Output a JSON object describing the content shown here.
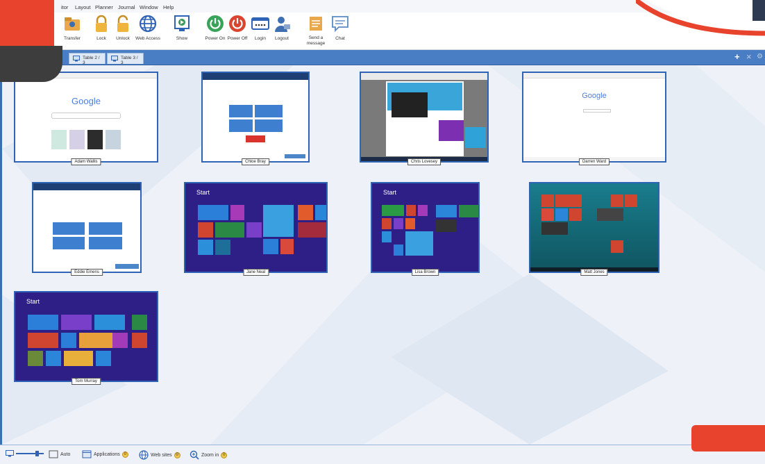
{
  "menu": [
    "itor",
    "Layout",
    "Planner",
    "Journal",
    "Window",
    "Help"
  ],
  "toolbar": [
    {
      "label": "Transfer",
      "icon": "folder-transfer-icon"
    },
    {
      "label": "Lock",
      "icon": "lock-icon"
    },
    {
      "label": "Unlock",
      "icon": "unlock-icon"
    },
    {
      "label": "Web Access",
      "icon": "globe-icon"
    },
    {
      "label": "Show",
      "icon": "show-screen-icon"
    },
    {
      "label": "Power On",
      "icon": "power-on-icon"
    },
    {
      "label": "Power Off",
      "icon": "power-off-icon"
    },
    {
      "label": "Login",
      "icon": "login-icon"
    },
    {
      "label": "Logout",
      "icon": "logout-icon"
    },
    {
      "label": "Send a\nmessage",
      "icon": "message-icon"
    },
    {
      "label": "Chat",
      "icon": "chat-icon"
    }
  ],
  "tabs": [
    "Table 2 / 3",
    "Table 3 / 3"
  ],
  "students": [
    "Adam Wallis",
    "Chloe Bray",
    "Chris Lovesey",
    "Darren Ward",
    "Eddie Emens",
    "Jane Neal",
    "Lisa Brown",
    "Matt Jones",
    "Tom Murray"
  ],
  "screen_text": {
    "google": "Google",
    "start": "Start"
  },
  "statusbar": {
    "auto": "Auto",
    "applications": "Applications",
    "applications_count": "0",
    "websites": "Web sites",
    "websites_count": "0",
    "zoom": "Zoom in",
    "zoom_count": "0"
  },
  "colors": {
    "accent": "#4a7ec4",
    "win8_bg": "#2d1f86",
    "overlay_red": "#e8432d"
  }
}
